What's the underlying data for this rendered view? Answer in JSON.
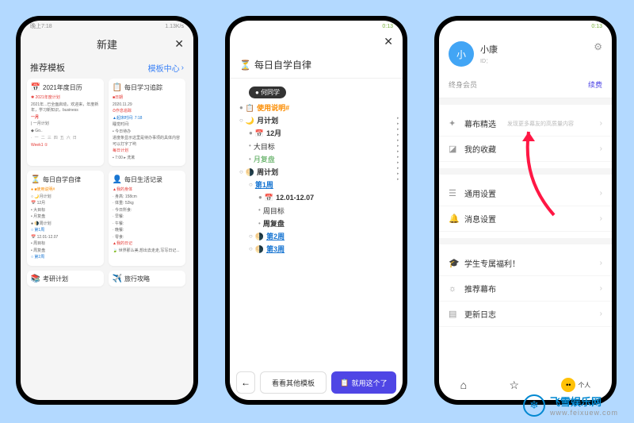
{
  "status": {
    "time_left": "晚上7:18",
    "signal_right": "1.13K/s",
    "time_green": "0:13"
  },
  "screen1": {
    "title": "新建",
    "subtitle": "推荐模板",
    "template_center": "模板中心",
    "cards": {
      "c1": {
        "title": "2021年度日历",
        "sub1": "✱ 2021年度计划",
        "sub2": "2021年...已全面启动，欢迎来，年度新年，学习新知识，business",
        "heading": "一月",
        "line1": "| 一月计划",
        "line2": "◆ Go..",
        "footer": "Week1 ①"
      },
      "c2": {
        "title": "每日学习追踪",
        "h1": "■日期",
        "d1": "2020.11.29",
        "h2": "⏱作息追踪",
        "d2a": "▲起床时间: 7:18",
        "d2b": "睡觉时间:",
        "h3": "• 今日待办",
        "d3": "进度条显示这里是待办事项的具体内容可以打字了哟",
        "h4": "每日计划",
        "d4": "▪ 7:00 ▸ 洗漱"
      },
      "c3": {
        "title": "每日自学自律",
        "l1": "● ■使用说明#",
        "l2": "○ 🌙月计划",
        "l3": "  📅 12月",
        "l4": "  • 大目标",
        "l5": "  • 月复盘",
        "l6": "● 🌗周计划",
        "l7": "  ○ 第1周",
        "l8": "    📅 12.01-12.07",
        "l9": "    • 周目标",
        "l10": "    • 周复盘",
        "l11": "  ○ 第2周"
      },
      "c4": {
        "title": "每日生活记录",
        "h1": "▲我的身体",
        "l1": "· 身高: 158cm",
        "l2": "· 体重: 52kg",
        "l3": "· 今日所食:",
        "l4": "  · 早餐:",
        "l5": "  · 午餐:",
        "l6": "  · 晚餐:",
        "l7": "  · 零食:",
        "h2": "▲我的日记",
        "l8": "  🍃 世界那么美,想出去走走,写写日记..."
      },
      "c5": {
        "title": "考研计划"
      },
      "c6": {
        "title": "旅行攻略"
      }
    },
    "days": [
      "一",
      "二",
      "三",
      "四",
      "五",
      "六",
      "日"
    ]
  },
  "screen2": {
    "title": "每日自学自律",
    "author": "何同学",
    "outline": {
      "i1": "使用说明#",
      "i2": "月计划",
      "i3": "12月",
      "i4": "大目标",
      "i5": "月复盘",
      "i6": "周计划",
      "i7": "第1周",
      "i8": "12.01-12.07",
      "i9": "周目标",
      "i10": "周复盘",
      "i11": "第2周",
      "i12": "第3周"
    },
    "buttons": {
      "other": "看看其他模板",
      "use": "就用这个了"
    }
  },
  "screen3": {
    "name": "小康",
    "avatar_char": "小",
    "id_label": "ID：",
    "member": "终身会员",
    "renew": "续费",
    "menu": {
      "m1": "幕布精选",
      "m1_sub": "发现更多幕友的高质量内容",
      "m2": "我的收藏",
      "m3": "通用设置",
      "m4": "消息设置",
      "m5": "学生专属福利！",
      "m6": "推荐幕布",
      "m7": "更新日志"
    },
    "nav_label": "个人"
  },
  "watermark": {
    "name": "飞雪娱乐网",
    "url": "www.feixuew.com"
  }
}
